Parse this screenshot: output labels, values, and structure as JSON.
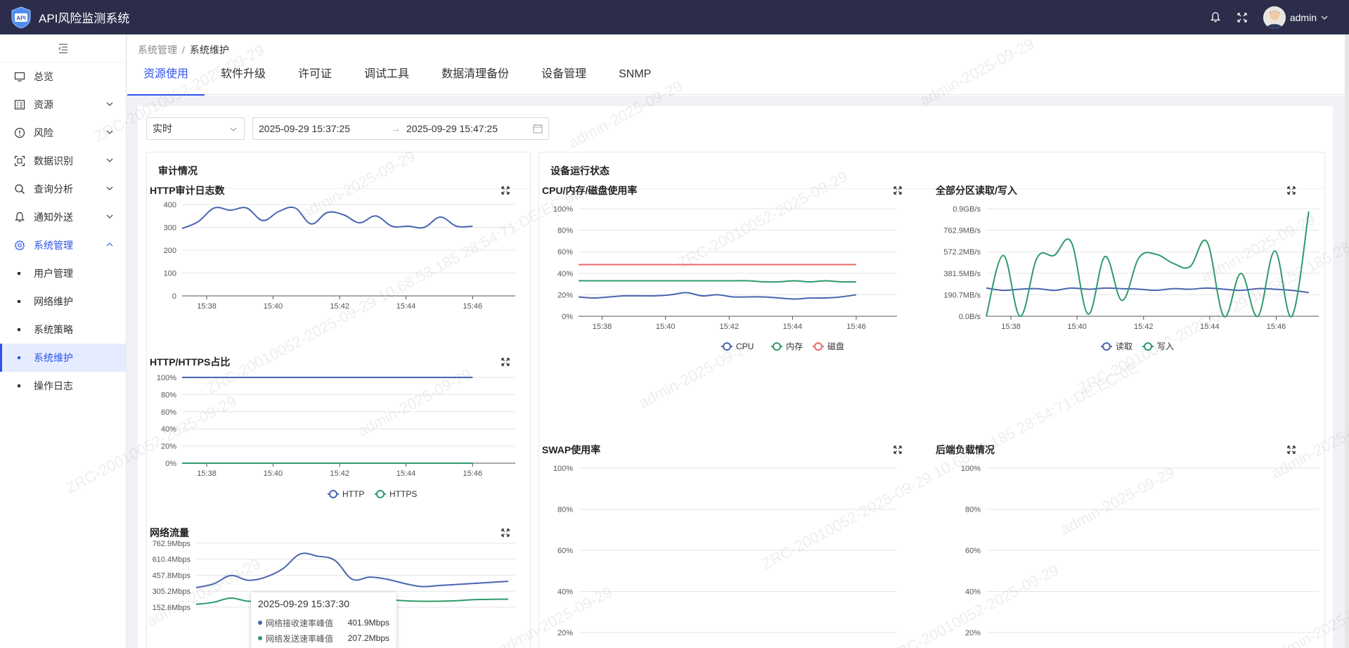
{
  "app": {
    "title": "API风险监测系统",
    "logo_text": "API"
  },
  "user": {
    "name": "admin"
  },
  "sidebar": {
    "items": [
      {
        "label": "总览",
        "icon": "monitor-icon"
      },
      {
        "label": "资源",
        "icon": "list-icon"
      },
      {
        "label": "风险",
        "icon": "warning-circle-icon"
      },
      {
        "label": "数据识别",
        "icon": "scan-icon"
      },
      {
        "label": "查询分析",
        "icon": "search-icon"
      },
      {
        "label": "通知外送",
        "icon": "bell-icon"
      },
      {
        "label": "系统管理",
        "icon": "gear-icon"
      }
    ],
    "sub_items": [
      {
        "label": "用户管理"
      },
      {
        "label": "网络维护"
      },
      {
        "label": "系统策略"
      },
      {
        "label": "系统维护"
      },
      {
        "label": "操作日志"
      }
    ]
  },
  "breadcrumb": {
    "parent": "系统管理",
    "separator": "/",
    "current": "系统维护"
  },
  "tabs": [
    {
      "label": "资源使用"
    },
    {
      "label": "软件升级"
    },
    {
      "label": "许可证"
    },
    {
      "label": "调试工具"
    },
    {
      "label": "数据清理备份"
    },
    {
      "label": "设备管理"
    },
    {
      "label": "SNMP"
    }
  ],
  "filters": {
    "mode": "实时",
    "start": "2025-09-29 15:37:25",
    "arrow": "→",
    "end": "2025-09-29 15:47:25"
  },
  "audit": {
    "title": "审计情况"
  },
  "device": {
    "title": "设备运行状态"
  },
  "tooltip": {
    "time": "2025-09-29 15:37:30",
    "rows": [
      {
        "label": "网络接收速率峰值",
        "value": "401.9Mbps",
        "color": "#4a65b0"
      },
      {
        "label": "网络发送速率峰值",
        "value": "207.2Mbps",
        "color": "#2e9a6a"
      }
    ]
  },
  "watermarks": [
    "ZRC-20010052-2025-09-29",
    "admin-2025-09-29",
    "ZRC-20010052-2025-09-29 10.68.53.185 28:54:71:DE:EC:6E"
  ],
  "chart_data": [
    {
      "type": "line",
      "title": "HTTP审计日志数",
      "x": [
        "15:37",
        "15:37:30",
        "15:38",
        "15:38:30",
        "15:39",
        "15:39:30",
        "15:40",
        "15:40:30",
        "15:41",
        "15:41:30",
        "15:42",
        "15:42:30",
        "15:43",
        "15:43:30",
        "15:44",
        "15:44:30",
        "15:45",
        "15:45:30",
        "15:46"
      ],
      "x_ticks": [
        "15:38",
        "15:40",
        "15:42",
        "15:44",
        "15:46"
      ],
      "ylim": [
        0,
        400
      ],
      "y_ticks": [
        "0",
        "100",
        "200",
        "300",
        "400"
      ],
      "series": [
        {
          "values": [
            295,
            325,
            385,
            375,
            385,
            330,
            370,
            385,
            315,
            365,
            355,
            320,
            350,
            305,
            305,
            300,
            345,
            305,
            305
          ]
        }
      ],
      "colors": [
        "#4a65b0"
      ]
    },
    {
      "type": "line",
      "title": "HTTP/HTTPS占比",
      "x": [
        "15:37",
        "15:46"
      ],
      "x_ticks": [
        "15:38",
        "15:40",
        "15:42",
        "15:44",
        "15:46"
      ],
      "ylim": [
        0,
        100
      ],
      "y_ticks": [
        "0%",
        "20%",
        "40%",
        "60%",
        "80%",
        "100%"
      ],
      "series": [
        {
          "name": "HTTP",
          "values": [
            100,
            100
          ]
        },
        {
          "name": "HTTPS",
          "values": [
            0,
            0
          ]
        }
      ],
      "colors": [
        "#4a65b0",
        "#2e9a6a"
      ]
    },
    {
      "type": "line",
      "title": "网络流量",
      "x": [
        "15:37",
        "15:37:30",
        "15:38",
        "15:38:30",
        "15:39",
        "15:39:30",
        "15:40",
        "15:40:30",
        "15:41",
        "15:41:30",
        "15:42",
        "15:42:30",
        "15:43",
        "15:43:30",
        "15:44",
        "15:44:30",
        "15:45",
        "15:45:30",
        "15:46"
      ],
      "y_ticks": [
        "152.6Mbps",
        "305.2Mbps",
        "457.8Mbps",
        "610.4Mbps",
        "762.9Mbps"
      ],
      "ylim": [
        0,
        762.9
      ],
      "series": [
        {
          "name": "网络接收速率峰值",
          "values": [
            340,
            375,
            455,
            410,
            440,
            520,
            660,
            640,
            600,
            420,
            440,
            420,
            380,
            350,
            360,
            370,
            380,
            390,
            400
          ]
        },
        {
          "name": "网络发送速率峰值",
          "values": [
            180,
            200,
            240,
            210,
            220,
            250,
            260,
            255,
            250,
            240,
            230,
            225,
            215,
            210,
            210,
            215,
            225,
            228,
            230
          ]
        }
      ],
      "colors": [
        "#4a65b0",
        "#2e9a6a"
      ]
    },
    {
      "type": "line",
      "title": "CPU/内存/磁盘使用率",
      "x": [
        "15:37",
        "15:37:30",
        "15:38",
        "15:38:30",
        "15:39",
        "15:39:30",
        "15:40",
        "15:40:30",
        "15:41",
        "15:41:30",
        "15:42",
        "15:42:30",
        "15:43",
        "15:43:30",
        "15:44",
        "15:44:30",
        "15:45",
        "15:45:30",
        "15:46"
      ],
      "x_ticks": [
        "15:38",
        "15:40",
        "15:42",
        "15:44",
        "15:46"
      ],
      "ylim": [
        0,
        100
      ],
      "y_ticks": [
        "0%",
        "20%",
        "40%",
        "60%",
        "80%",
        "100%"
      ],
      "series": [
        {
          "name": "CPU",
          "values": [
            18,
            17,
            18,
            19,
            19,
            19,
            20,
            22,
            19,
            20,
            18,
            18,
            18,
            17,
            16,
            17,
            17,
            18,
            20
          ]
        },
        {
          "name": "内存",
          "values": [
            33,
            33,
            33,
            33,
            33,
            33,
            33,
            33,
            33,
            33,
            33,
            33,
            32,
            32,
            33,
            32,
            33,
            32,
            32
          ]
        },
        {
          "name": "磁盘",
          "values": [
            48,
            48,
            48,
            48,
            48,
            48,
            48,
            48,
            48,
            48,
            48,
            48,
            48,
            48,
            48,
            48,
            48,
            48,
            48
          ]
        }
      ],
      "colors": [
        "#4a65b0",
        "#2e9a6a",
        "#e86868"
      ]
    },
    {
      "type": "line",
      "title": "全部分区读取/写入",
      "x": [
        "15:37",
        "15:37:30",
        "15:38",
        "15:38:30",
        "15:39",
        "15:39:30",
        "15:40",
        "15:40:30",
        "15:41",
        "15:41:30",
        "15:42",
        "15:42:30",
        "15:43",
        "15:43:30",
        "15:44",
        "15:44:30",
        "15:45",
        "15:45:30",
        "15:46",
        "15:46:30"
      ],
      "x_ticks": [
        "15:38",
        "15:40",
        "15:42",
        "15:44",
        "15:46"
      ],
      "ylim": [
        0,
        953.6
      ],
      "y_ticks": [
        "0.0B/s",
        "190.7MB/s",
        "381.5MB/s",
        "572.2MB/s",
        "762.9MB/s",
        "0.9GB/s"
      ],
      "series": [
        {
          "name": "读取",
          "values": [
            250,
            230,
            240,
            245,
            230,
            250,
            240,
            250,
            245,
            240,
            230,
            245,
            240,
            250,
            240,
            230,
            245,
            240,
            230,
            210
          ]
        },
        {
          "name": "写入",
          "values": [
            0,
            540,
            0,
            520,
            540,
            660,
            20,
            530,
            140,
            520,
            550,
            470,
            440,
            660,
            0,
            380,
            0,
            580,
            0,
            930
          ]
        }
      ],
      "colors": [
        "#4a65b0",
        "#2e9a6a"
      ]
    },
    {
      "type": "line",
      "title": "SWAP使用率",
      "y_ticks": [
        "20%",
        "40%",
        "60%",
        "80%",
        "100%"
      ],
      "ylim": [
        0,
        100
      ],
      "series": []
    },
    {
      "type": "line",
      "title": "后端负载情况",
      "y_ticks": [
        "20%",
        "40%",
        "60%",
        "80%",
        "100%"
      ],
      "ylim": [
        0,
        100
      ],
      "series": []
    }
  ]
}
